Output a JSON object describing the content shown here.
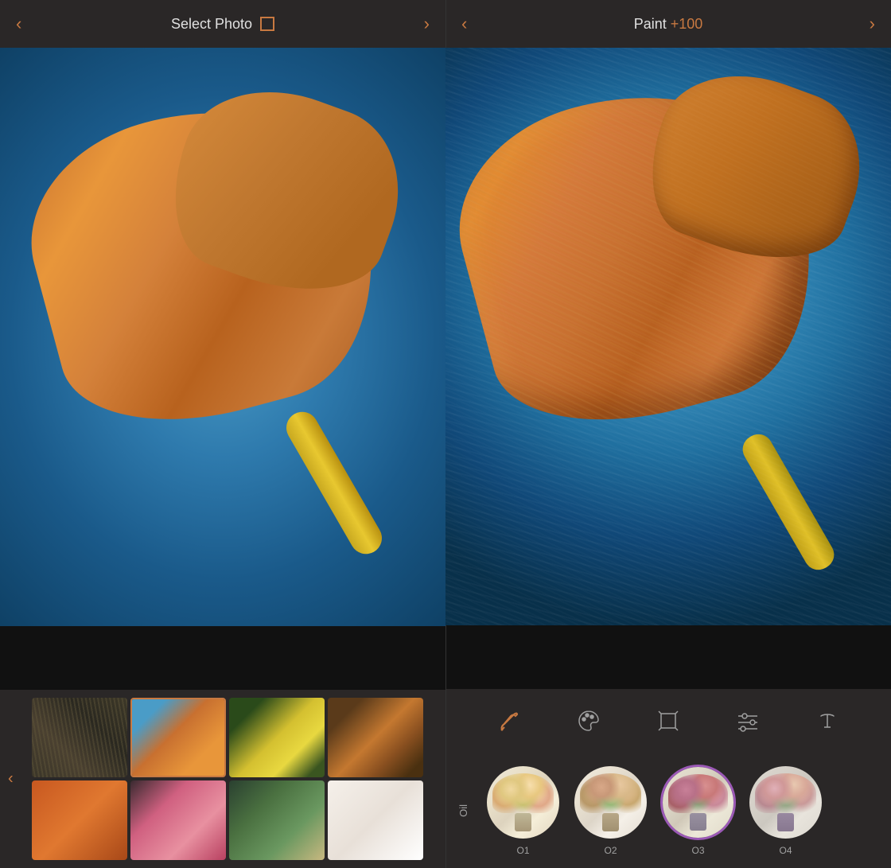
{
  "left_panel": {
    "header": {
      "title": "Select Photo",
      "nav_prev": "‹",
      "nav_next": "›"
    },
    "thumbnails_nav": "‹",
    "thumbnails": [
      {
        "id": "t1",
        "label": "sticks",
        "type": "sticks",
        "selected": false
      },
      {
        "id": "t2",
        "label": "dried-flower",
        "type": "flower-dried",
        "selected": true
      },
      {
        "id": "t3",
        "label": "yellow-flower",
        "type": "yellow-flower",
        "selected": false
      },
      {
        "id": "t4",
        "label": "dried-leaves",
        "type": "dried-leaves",
        "selected": false
      }
    ],
    "thumbnails_row2": [
      {
        "id": "t5",
        "label": "orange-texture",
        "type": "orange-texture"
      },
      {
        "id": "t6",
        "label": "pink-rose",
        "type": "pink-rose"
      },
      {
        "id": "t7",
        "label": "green-hand",
        "type": "green-hand"
      },
      {
        "id": "t8",
        "label": "white-flower",
        "type": "white-flower"
      }
    ]
  },
  "right_panel": {
    "header": {
      "title": "Paint",
      "value": "+100",
      "nav_prev": "‹",
      "nav_next": "›"
    },
    "tools": [
      {
        "id": "brush",
        "icon": "brush",
        "label": "Brush"
      },
      {
        "id": "palette",
        "icon": "palette",
        "label": "Palette"
      },
      {
        "id": "canvas",
        "icon": "canvas",
        "label": "Canvas"
      },
      {
        "id": "adjust",
        "icon": "adjust",
        "label": "Adjust"
      },
      {
        "id": "text",
        "icon": "text",
        "label": "Text"
      }
    ],
    "filter_label": "Oil",
    "filters": [
      {
        "id": "o1",
        "name": "O1",
        "active": false
      },
      {
        "id": "o2",
        "name": "O2",
        "active": false
      },
      {
        "id": "o3",
        "name": "O3",
        "active": true
      },
      {
        "id": "o4",
        "name": "O4",
        "active": false
      }
    ]
  },
  "colors": {
    "accent": "#c87941",
    "active_filter_border": "#9b59b6",
    "header_bg": "#2a2727",
    "panel_bg": "#1a1a1a",
    "text_primary": "#e0e0e0",
    "text_secondary": "#a0a0a0"
  }
}
